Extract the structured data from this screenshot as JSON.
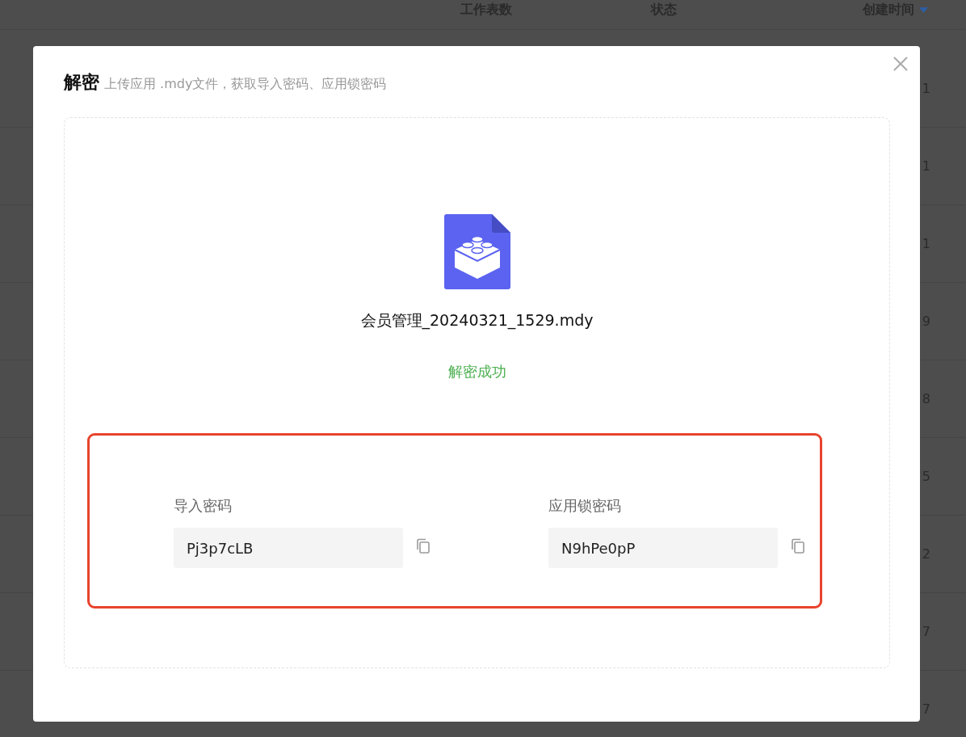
{
  "background_table": {
    "columns": [
      "工作表数",
      "状态",
      "创建时间"
    ],
    "column_3_values": [
      "1",
      "1",
      "1",
      "9",
      "8",
      "5",
      "2",
      "7",
      "7"
    ]
  },
  "dialog": {
    "title": "解密",
    "subtitle": "上传应用 .mdy文件，获取导入密码、应用锁密码",
    "file_name": "会员管理_20240321_1529.mdy",
    "status": "解密成功",
    "fields": [
      {
        "label": "导入密码",
        "value": "Pj3p7cLB"
      },
      {
        "label": "应用锁密码",
        "value": "N9hPe0pP"
      }
    ]
  }
}
